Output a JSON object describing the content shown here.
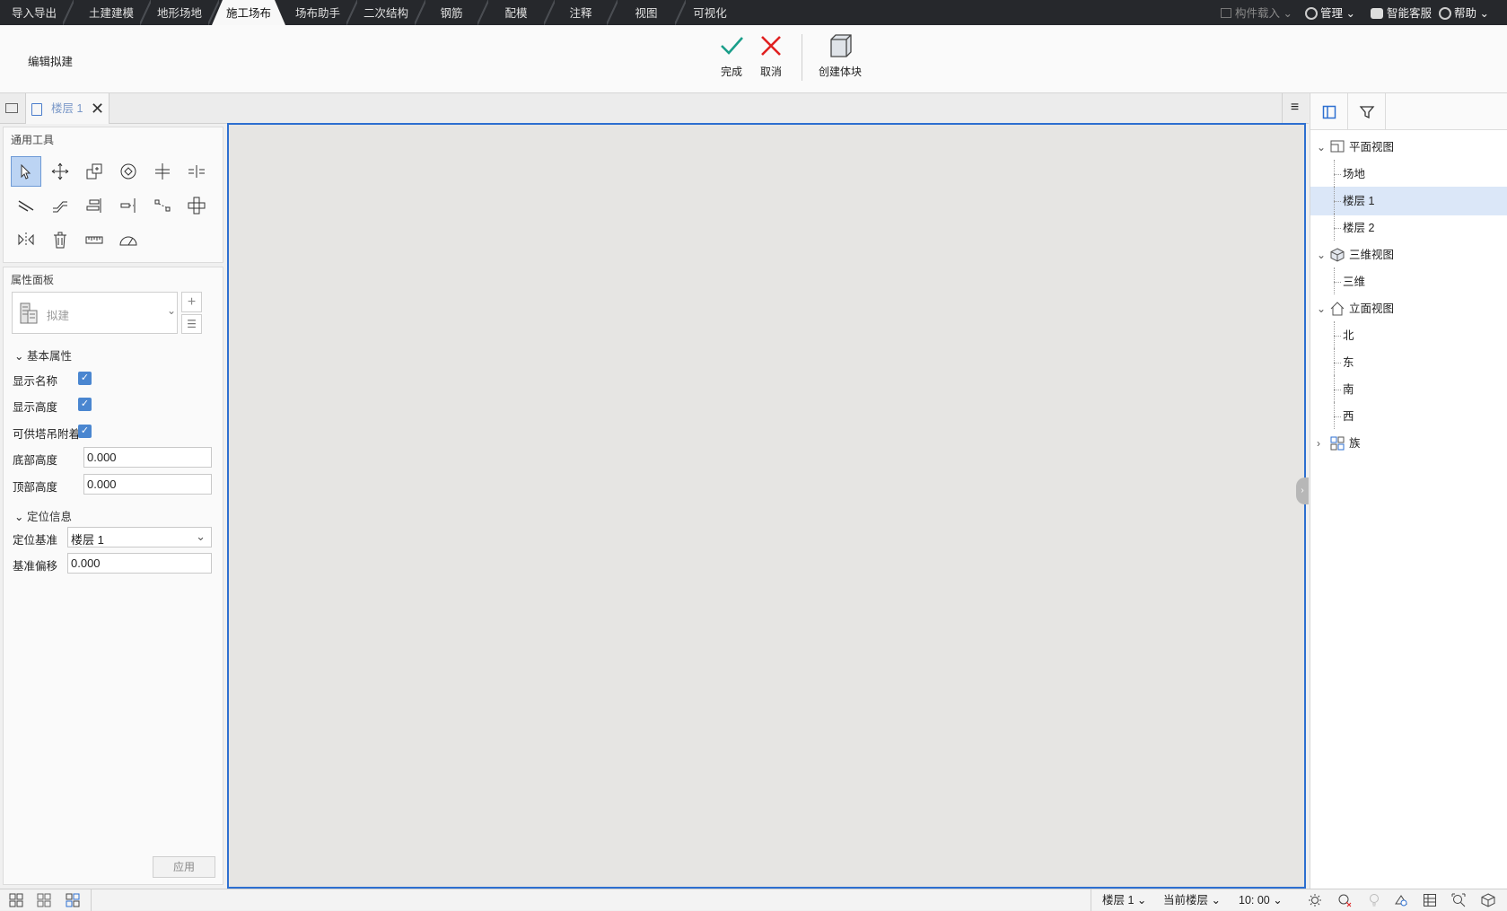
{
  "menu_tabs": [
    "导入导出",
    "土建建模",
    "地形场地",
    "施工场布",
    "场布助手",
    "二次结构",
    "钢筋",
    "配模",
    "注释",
    "视图",
    "可视化"
  ],
  "active_tab": "施工场布",
  "top_right": {
    "component_load": "构件载入",
    "manage": "管理",
    "smart_service": "智能客服",
    "help": "帮助"
  },
  "ribbon": {
    "title": "编辑拟建",
    "finish": "完成",
    "cancel": "取消",
    "create_block": "创建体块"
  },
  "doc_tab": {
    "label": "楼层 1"
  },
  "tools": {
    "title": "通用工具",
    "icons": [
      "select-icon",
      "move-icon",
      "copy-icon",
      "rotate-icon",
      "trim-icon",
      "split-icon",
      "offset-icon",
      "stretch-icon",
      "align-icon",
      "extend-icon",
      "break-icon",
      "array-icon",
      "mirror-icon",
      "delete-icon",
      "measure-icon",
      "angle-measure-icon"
    ]
  },
  "properties": {
    "title": "属性面板",
    "type_name": "拟建",
    "basic_header": "基本属性",
    "rows": [
      {
        "label": "显示名称",
        "checked": true
      },
      {
        "label": "显示高度",
        "checked": true
      },
      {
        "label": "可供塔吊附着",
        "checked": true
      }
    ],
    "bottom_height_label": "底部高度",
    "bottom_height": "0.000",
    "top_height_label": "顶部高度",
    "top_height": "0.000",
    "position_header": "定位信息",
    "base_label": "定位基准",
    "base_value": "楼层 1",
    "offset_label": "基准偏移",
    "offset_value": "0.000",
    "apply": "应用"
  },
  "tree": [
    {
      "label": "平面视图",
      "level": 0,
      "expanded": true,
      "icon": "plan-view-icon"
    },
    {
      "label": "场地",
      "level": 1
    },
    {
      "label": "楼层 1",
      "level": 1,
      "selected": true
    },
    {
      "label": "楼层 2",
      "level": 1
    },
    {
      "label": "三维视图",
      "level": 0,
      "expanded": true,
      "icon": "cube-icon"
    },
    {
      "label": "三维",
      "level": 1
    },
    {
      "label": "立面视图",
      "level": 0,
      "expanded": true,
      "icon": "elevation-icon"
    },
    {
      "label": "北",
      "level": 1
    },
    {
      "label": "东",
      "level": 1
    },
    {
      "label": "南",
      "level": 1
    },
    {
      "label": "西",
      "level": 1
    },
    {
      "label": "族",
      "level": 0,
      "expanded": false,
      "icon": "family-icon"
    }
  ],
  "status": {
    "floor": "楼层 1",
    "current_floor": "当前楼层",
    "time": "10: 00"
  },
  "colors": {
    "accent": "#2d6fd0",
    "finish": "#1a9e8a",
    "cancel": "#e02020",
    "topbar": "#26282c"
  }
}
